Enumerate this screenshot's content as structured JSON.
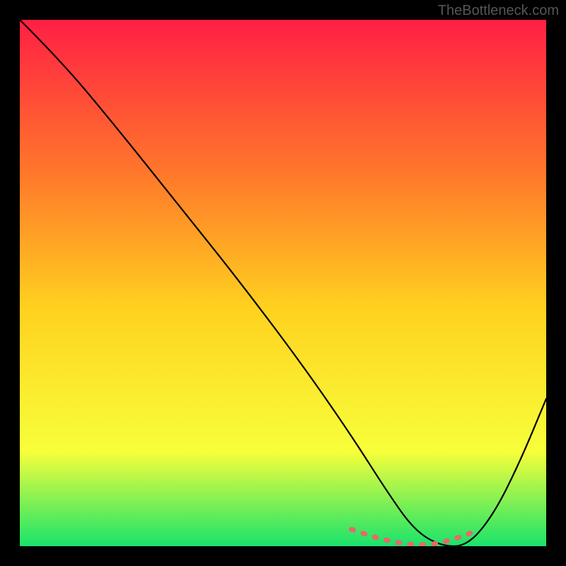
{
  "watermark": "TheBottleneck.com",
  "chart_data": {
    "type": "line",
    "title": "",
    "xlabel": "",
    "ylabel": "",
    "xlim": [
      0,
      100
    ],
    "ylim": [
      0,
      100
    ],
    "gradient_colors": {
      "top": "#ff1f44",
      "upper_mid": "#ff7a2a",
      "mid": "#ffd21f",
      "lower_mid": "#f7ff3a",
      "bottom": "#19e36b"
    },
    "series": [
      {
        "name": "curve-primary",
        "stroke": "#000000",
        "x": [
          0,
          8,
          18,
          30,
          42,
          54,
          63,
          70,
          75,
          80,
          85,
          90,
          95,
          100
        ],
        "y": [
          100,
          92,
          80,
          65,
          50,
          34,
          21,
          10,
          3,
          0,
          0,
          6,
          16,
          28
        ]
      },
      {
        "name": "highlight-valley",
        "stroke": "#e46a6a",
        "style": "dashed",
        "x": [
          63,
          67,
          71,
          75,
          79,
          83,
          87
        ],
        "y": [
          3.2,
          1.8,
          0.8,
          0.2,
          0.4,
          1.5,
          3.0
        ]
      }
    ]
  }
}
